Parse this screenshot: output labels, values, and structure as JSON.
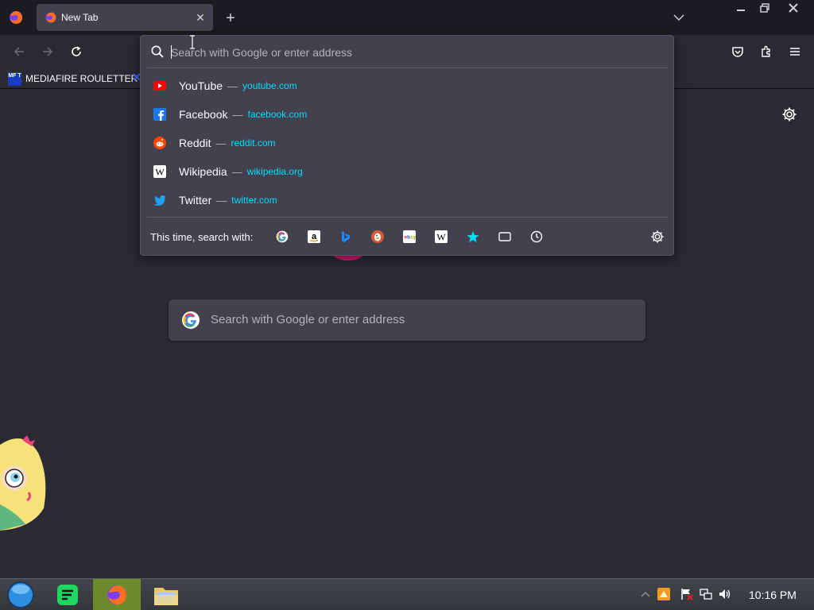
{
  "tab": {
    "title": "New Tab"
  },
  "bookmarks": {
    "items": [
      {
        "label": "MEDIAFIRE ROULETTER",
        "logo_text": "MF T"
      }
    ]
  },
  "urlbar": {
    "placeholder": "Search with Google or enter address"
  },
  "results": [
    {
      "title": "YouTube",
      "separator": "—",
      "url": "youtube.com",
      "icon": "youtube-icon"
    },
    {
      "title": "Facebook",
      "separator": "—",
      "url": "facebook.com",
      "icon": "facebook-icon"
    },
    {
      "title": "Reddit",
      "separator": "—",
      "url": "reddit.com",
      "icon": "reddit-icon"
    },
    {
      "title": "Wikipedia",
      "separator": "—",
      "url": "wikipedia.org",
      "icon": "wikipedia-icon"
    },
    {
      "title": "Twitter",
      "separator": "—",
      "url": "twitter.com",
      "icon": "twitter-icon"
    }
  ],
  "oneoffs": {
    "label": "This time, search with:",
    "engines": [
      "google-icon",
      "amazon-icon",
      "bing-icon",
      "duckduckgo-icon",
      "ebay-icon",
      "wikipedia-icon",
      "bookmarks-star-icon",
      "tabs-icon",
      "history-icon"
    ]
  },
  "newtab": {
    "search_placeholder": "Search with Google or enter address"
  },
  "taskbar": {
    "clock": "10:16 PM"
  },
  "colors": {
    "accent_url": "#00ddff",
    "panel_bg": "#42414d",
    "page_bg": "#2b2a33",
    "active_taskbar": "#6b8a2b"
  }
}
